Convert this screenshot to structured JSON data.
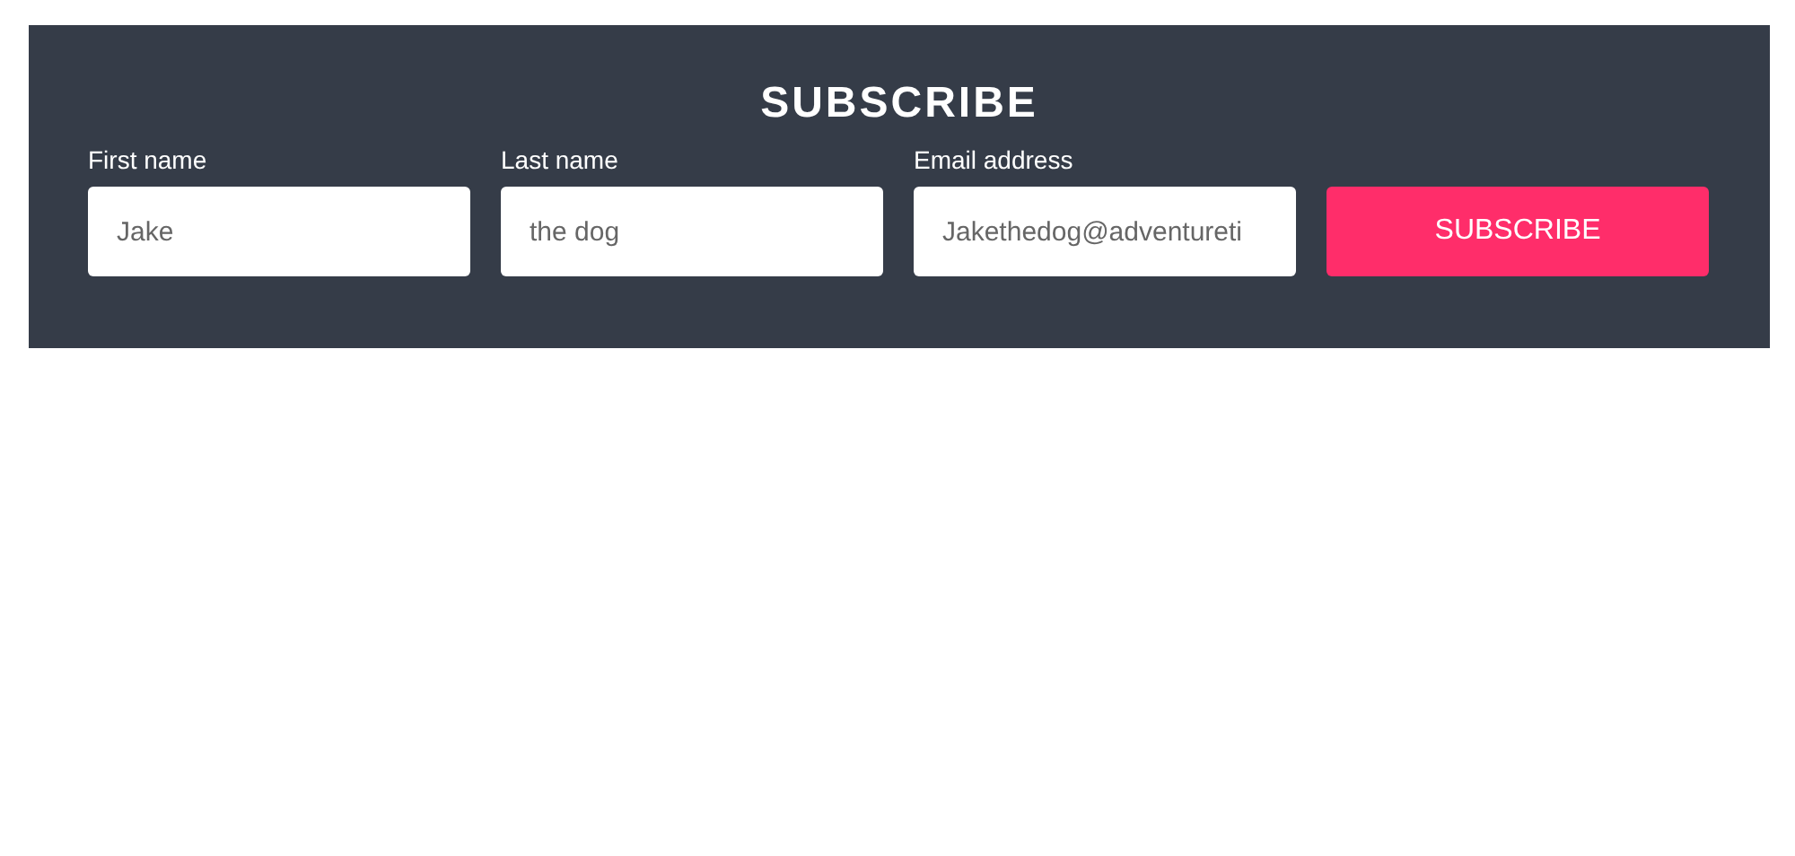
{
  "title": "SUBSCRIBE",
  "fields": [
    {
      "label": "First name",
      "value": "Jake"
    },
    {
      "label": "Last name",
      "value": "the dog"
    },
    {
      "label": "Email address",
      "value": "Jakethedog@adventureti"
    }
  ],
  "button": {
    "label": "SUBSCRIBE"
  }
}
